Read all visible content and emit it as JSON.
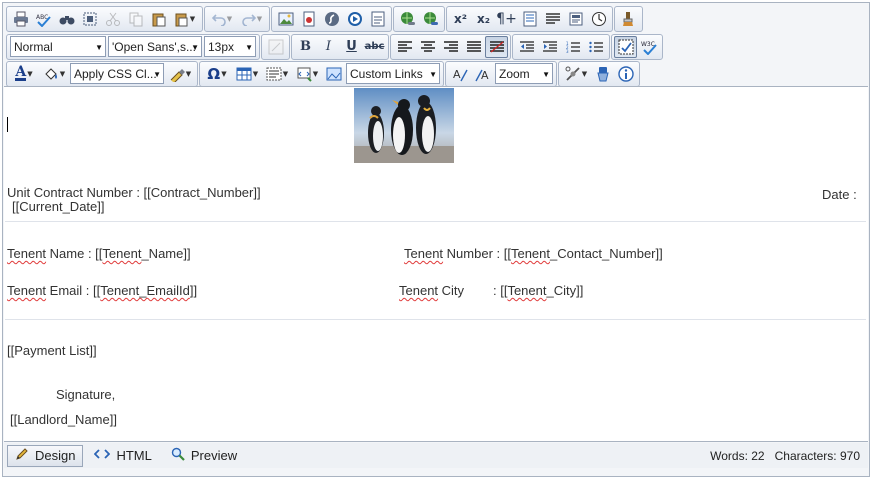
{
  "toolbar": {
    "paragraph_format": "Normal",
    "font_family": "'Open Sans',s...",
    "font_size": "13px",
    "css_class": "Apply CSS Cl...",
    "custom_links": "Custom Links",
    "zoom": "Zoom",
    "bold_label": "B",
    "italic_label": "I",
    "underline_label": "U",
    "strike_label": "abc",
    "spell_label": "ABC",
    "omega_label": "Ω",
    "font_color_label": "A",
    "w3c_label": "W3C",
    "superscript_label": "x²",
    "subscript_label": "x₂",
    "pilcrow_label": "¶+"
  },
  "document": {
    "contract_line": "Unit Contract Number : [[Contract_Number]]",
    "date_label": "Date :",
    "current_date": "[[Current_Date]]",
    "tenant_name_label": "Tenent",
    "tenant_name_rest": " Name : [[",
    "tenant_name_token": "Tenent",
    "tenant_name_end": "_Name]]",
    "tenant_number_label": "Tenent",
    "tenant_number_rest": " Number :  [[",
    "tenant_number_token": "Tenent",
    "tenant_number_end": "_Contact_Number]]",
    "tenant_email_label": "Tenent",
    "tenant_email_rest": " Email  : [[",
    "tenant_email_token": "Tenent_EmailId",
    "tenant_email_end": "]]",
    "tenant_city_label": "Tenent",
    "tenant_city_rest": " City",
    "tenant_city_colon": ":  [[",
    "tenant_city_token": "Tenent",
    "tenant_city_end": "_City]]",
    "payment_list": "[[Payment List]]",
    "signature": "Signature,",
    "landlord_name": "[[Landlord_Name]]"
  },
  "statusbar": {
    "design_label": "Design",
    "html_label": "HTML",
    "preview_label": "Preview",
    "words": "Words: 22",
    "characters": "Characters: 970"
  }
}
